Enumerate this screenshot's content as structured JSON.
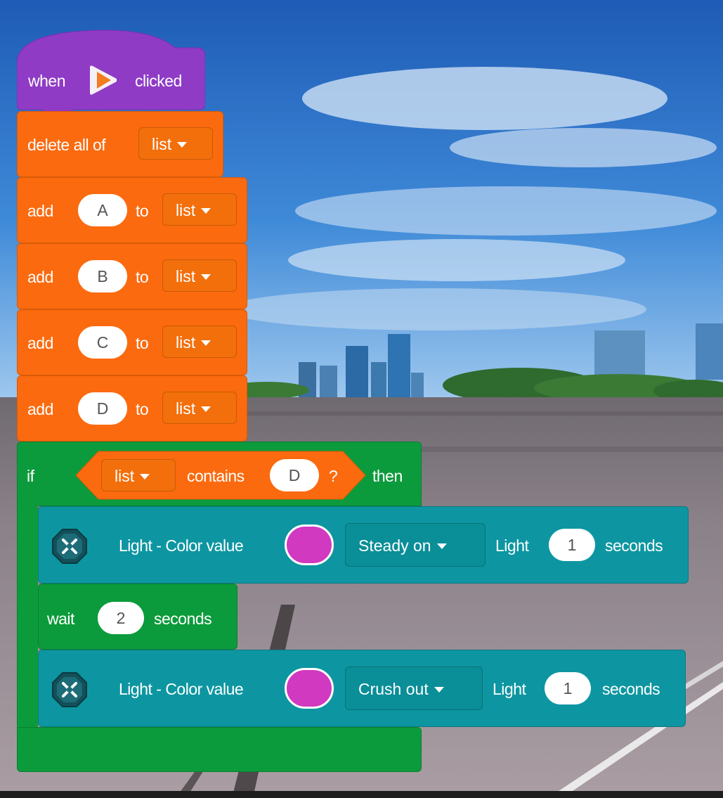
{
  "colors": {
    "event": "#8f3bc6",
    "variables": "#fb6a0f",
    "control": "#0c9b3c",
    "light": "#0d96a1",
    "light_color": "#d039c0"
  },
  "event_block": {
    "when": "when",
    "flag_icon": "play-flag-icon",
    "clicked": "clicked"
  },
  "delete_block": {
    "text": "delete all of",
    "list": "list"
  },
  "add_blocks": [
    {
      "add": "add",
      "value": "A",
      "to": "to",
      "list": "list"
    },
    {
      "add": "add",
      "value": "B",
      "to": "to",
      "list": "list"
    },
    {
      "add": "add",
      "value": "C",
      "to": "to",
      "list": "list"
    },
    {
      "add": "add",
      "value": "D",
      "to": "to",
      "list": "list"
    }
  ],
  "if_block": {
    "if": "if",
    "list": "list",
    "contains": "contains",
    "value": "D",
    "question": "?",
    "then": "then"
  },
  "light_blocks": [
    {
      "text": "Light - Color value",
      "mode": "Steady on",
      "light": "Light",
      "value": "1",
      "seconds": "seconds",
      "icon": "drone-light-icon"
    },
    {
      "text": "Light - Color value",
      "mode": "Crush out",
      "light": "Light",
      "value": "1",
      "seconds": "seconds",
      "icon": "drone-light-icon"
    }
  ],
  "wait_block": {
    "wait": "wait",
    "value": "2",
    "seconds": "seconds"
  }
}
